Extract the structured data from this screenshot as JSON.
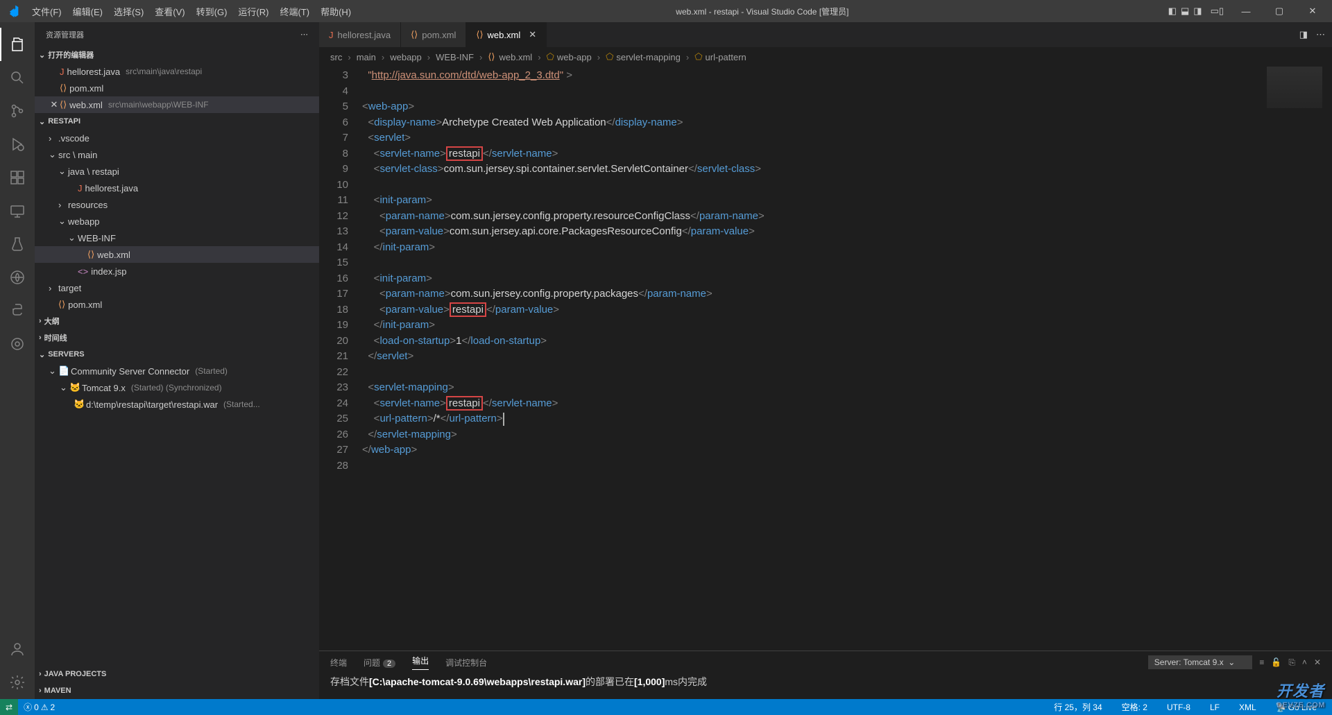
{
  "titlebar": {
    "menus": [
      "文件(F)",
      "编辑(E)",
      "选择(S)",
      "查看(V)",
      "转到(G)",
      "运行(R)",
      "终端(T)",
      "帮助(H)"
    ],
    "title": "web.xml - restapi - Visual Studio Code [管理员]"
  },
  "sidebar": {
    "title": "资源管理器",
    "openEditors": {
      "label": "打开的编辑器",
      "items": [
        {
          "name": "hellorest.java",
          "path": "src\\main\\java\\restapi",
          "icon": "J",
          "color": "#e76f51"
        },
        {
          "name": "pom.xml",
          "path": "",
          "icon": "⟨⟩",
          "color": "#f4a261"
        },
        {
          "name": "web.xml",
          "path": "src\\main\\webapp\\WEB-INF",
          "icon": "⟨⟩",
          "color": "#f4a261",
          "active": true
        }
      ]
    },
    "project": {
      "label": "RESTAPI",
      "tree": [
        {
          "indent": 1,
          "chev": "›",
          "name": ".vscode"
        },
        {
          "indent": 1,
          "chev": "⌄",
          "name": "src \\ main"
        },
        {
          "indent": 2,
          "chev": "⌄",
          "name": "java \\ restapi"
        },
        {
          "indent": 3,
          "chev": "",
          "name": "hellorest.java",
          "icon": "J",
          "color": "#e76f51"
        },
        {
          "indent": 2,
          "chev": "›",
          "name": "resources"
        },
        {
          "indent": 2,
          "chev": "⌄",
          "name": "webapp"
        },
        {
          "indent": 3,
          "chev": "⌄",
          "name": "WEB-INF"
        },
        {
          "indent": 4,
          "chev": "",
          "name": "web.xml",
          "icon": "⟨⟩",
          "color": "#f4a261",
          "active": true
        },
        {
          "indent": 3,
          "chev": "",
          "name": "index.jsp",
          "icon": "<>",
          "color": "#c586c0"
        },
        {
          "indent": 1,
          "chev": "›",
          "name": "target"
        },
        {
          "indent": 1,
          "chev": "",
          "name": "pom.xml",
          "icon": "⟨⟩",
          "color": "#f4a261"
        }
      ]
    },
    "outline": "大纲",
    "timeline": "时间线",
    "servers": {
      "label": "SERVERS",
      "csc": {
        "name": "Community Server Connector",
        "status": "(Started)"
      },
      "tomcat": {
        "name": "Tomcat 9.x",
        "status": "(Started) (Synchronized)"
      },
      "war": {
        "name": "d:\\temp\\restapi\\target\\restapi.war",
        "status": "(Started..."
      }
    },
    "javaProjects": "JAVA PROJECTS",
    "maven": "MAVEN"
  },
  "tabs": [
    {
      "name": "hellorest.java",
      "icon": "J",
      "color": "#e76f51"
    },
    {
      "name": "pom.xml",
      "icon": "⟨⟩",
      "color": "#f4a261"
    },
    {
      "name": "web.xml",
      "icon": "⟨⟩",
      "color": "#f4a261",
      "active": true
    }
  ],
  "breadcrumb": [
    "src",
    "main",
    "webapp",
    "WEB-INF",
    "web.xml",
    "web-app",
    "servlet-mapping",
    "url-pattern"
  ],
  "code": {
    "startLine": 3,
    "endLine": 28,
    "dtdUrl": "http://java.sun.com/dtd/web-app_2_3.dtd",
    "displayName": "Archetype Created Web Application",
    "servletName": "restapi",
    "servletClass": "com.sun.jersey.spi.container.servlet.ServletContainer",
    "param1Name": "com.sun.jersey.config.property.resourceConfigClass",
    "param1Value": "com.sun.jersey.api.core.PackagesResourceConfig",
    "param2Name": "com.sun.jersey.config.property.packages",
    "param2Value": "restapi",
    "loadOnStartup": "1",
    "urlPattern": "/*"
  },
  "panel": {
    "tabs": [
      "终端",
      "问题",
      "输出",
      "调试控制台"
    ],
    "problemsBadge": "2",
    "activeTab": "输出",
    "dropdown": "Server: Tomcat 9.x",
    "output": {
      "prefix": "存档文件",
      "path": "[C:\\apache-tomcat-9.0.69\\webapps\\restapi.war]",
      "middle": "的部署已在",
      "time": "[1,000]",
      "suffix": "ms内完成"
    }
  },
  "statusBar": {
    "errors": "0",
    "warnings": "2",
    "lineCol": "行 25，列 34",
    "spaces": "空格: 2",
    "encoding": "UTF-8",
    "eol": "LF",
    "lang": "XML",
    "golive": "Go Live"
  },
  "watermark": {
    "main": "开发者",
    "sub": "DEVZE.COM"
  }
}
